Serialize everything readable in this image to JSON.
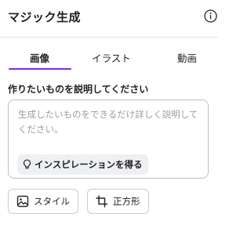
{
  "header": {
    "title": "マジック生成"
  },
  "tabs": [
    {
      "label": "画像",
      "active": true
    },
    {
      "label": "イラスト",
      "active": false
    },
    {
      "label": "動画",
      "active": false
    }
  ],
  "prompt": {
    "label": "作りたいものを説明してください",
    "placeholder": "生成したいものをできるだけ詳しく説明してください。",
    "inspiration_label": "インスピレーションを得る"
  },
  "options": {
    "style_label": "スタイル",
    "aspect_label": "正方形"
  },
  "colors": {
    "accent": "#7d2ae8",
    "border": "#bcbfc5",
    "placeholder_text": "#9a9ca3"
  }
}
